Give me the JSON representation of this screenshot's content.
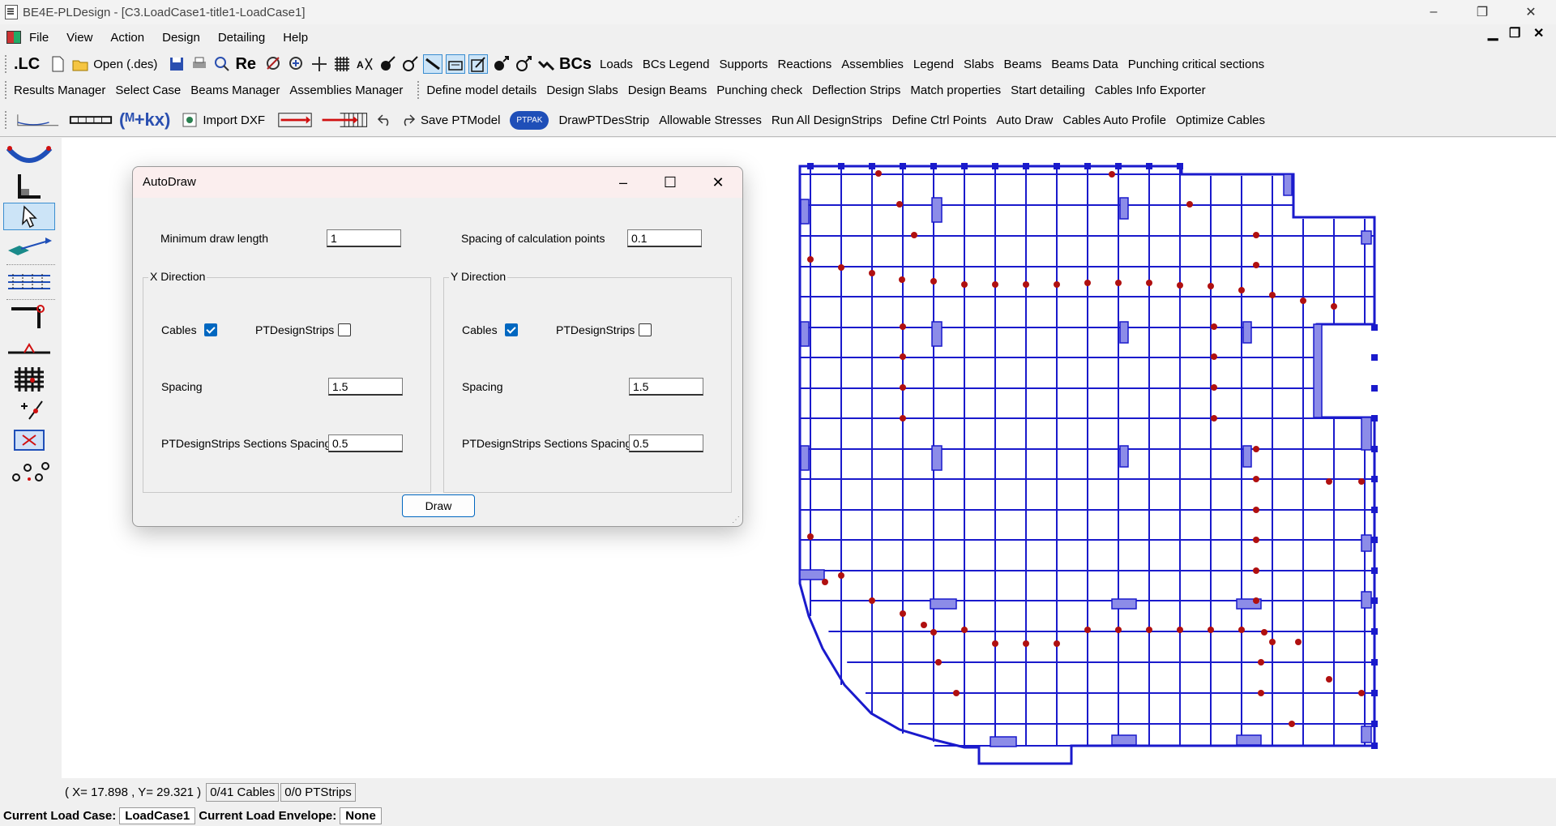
{
  "window": {
    "title": "BE4E-PLDesign - [C3.LoadCase1-title1-LoadCase1]",
    "minimize": "–",
    "restore": "❐",
    "close": "✕"
  },
  "mdi": {
    "minimize": "▁",
    "restore": "❐",
    "close": "✕"
  },
  "menu": [
    {
      "label": "File"
    },
    {
      "label": "View"
    },
    {
      "label": "Action"
    },
    {
      "label": "Design"
    },
    {
      "label": "Detailing"
    },
    {
      "label": "Help"
    }
  ],
  "toolbar1": {
    "lc": ".LC",
    "open": "Open (.des)",
    "re": "Re",
    "bcs": "BCs",
    "items": [
      "Loads",
      "BCs Legend",
      "Supports",
      "Reactions",
      "Assemblies",
      "Legend",
      "Slabs",
      "Beams",
      "Beams Data",
      "Punching critical sections"
    ]
  },
  "toolbar2": {
    "items": [
      "Results Manager",
      "Select Case",
      "Beams Manager",
      "Assemblies Manager"
    ],
    "items2": [
      "Define model details",
      "Design Slabs",
      "Design Beams",
      "Punching check",
      "Deflection Strips",
      "Match properties",
      "Start detailing",
      "Cables Info Exporter"
    ]
  },
  "toolbar3": {
    "formula": "(ᴹ+kx)",
    "import_dxf": "Import DXF",
    "save_pt": "Save PTModel",
    "ptpak": "PTPAK",
    "items": [
      "DrawPTDesStrip",
      "Allowable Stresses",
      "Run All DesignStrips",
      "Define Ctrl Points",
      "Auto Draw",
      "Cables Auto Profile",
      "Optimize Cables"
    ]
  },
  "dialog": {
    "title": "AutoDraw",
    "min_draw_label": "Minimum draw length",
    "min_draw_value": "1",
    "spacing_calc_label": "Spacing of calculation points",
    "spacing_calc_value": "0.1",
    "x": {
      "title": "X Direction",
      "cables_label": "Cables",
      "cables_checked": true,
      "strips_label": "PTDesignStrips",
      "strips_checked": false,
      "spacing_label": "Spacing",
      "spacing_value": "1.5",
      "sections_label": "PTDesignStrips Sections Spacing",
      "sections_value": "0.5"
    },
    "y": {
      "title": "Y Direction",
      "cables_label": "Cables",
      "cables_checked": true,
      "strips_label": "PTDesignStrips",
      "strips_checked": false,
      "spacing_label": "Spacing",
      "spacing_value": "1.5",
      "sections_label": "PTDesignStrips Sections Spacing",
      "sections_value": "0.5"
    },
    "draw_button": "Draw"
  },
  "status": {
    "coords": "( X= 17.898 , Y= 29.321 )",
    "cables": "0/41 Cables",
    "strips": "0/0 PTStrips"
  },
  "loadcase": {
    "case_label": "Current Load Case:",
    "case_value": "LoadCase1",
    "envelope_label": "Current Load Envelope:",
    "envelope_value": "None"
  },
  "colors": {
    "grid": "#1a1acc",
    "column_fill": "#8c8ce8",
    "point": "#b01010",
    "accent": "#0067c0"
  }
}
